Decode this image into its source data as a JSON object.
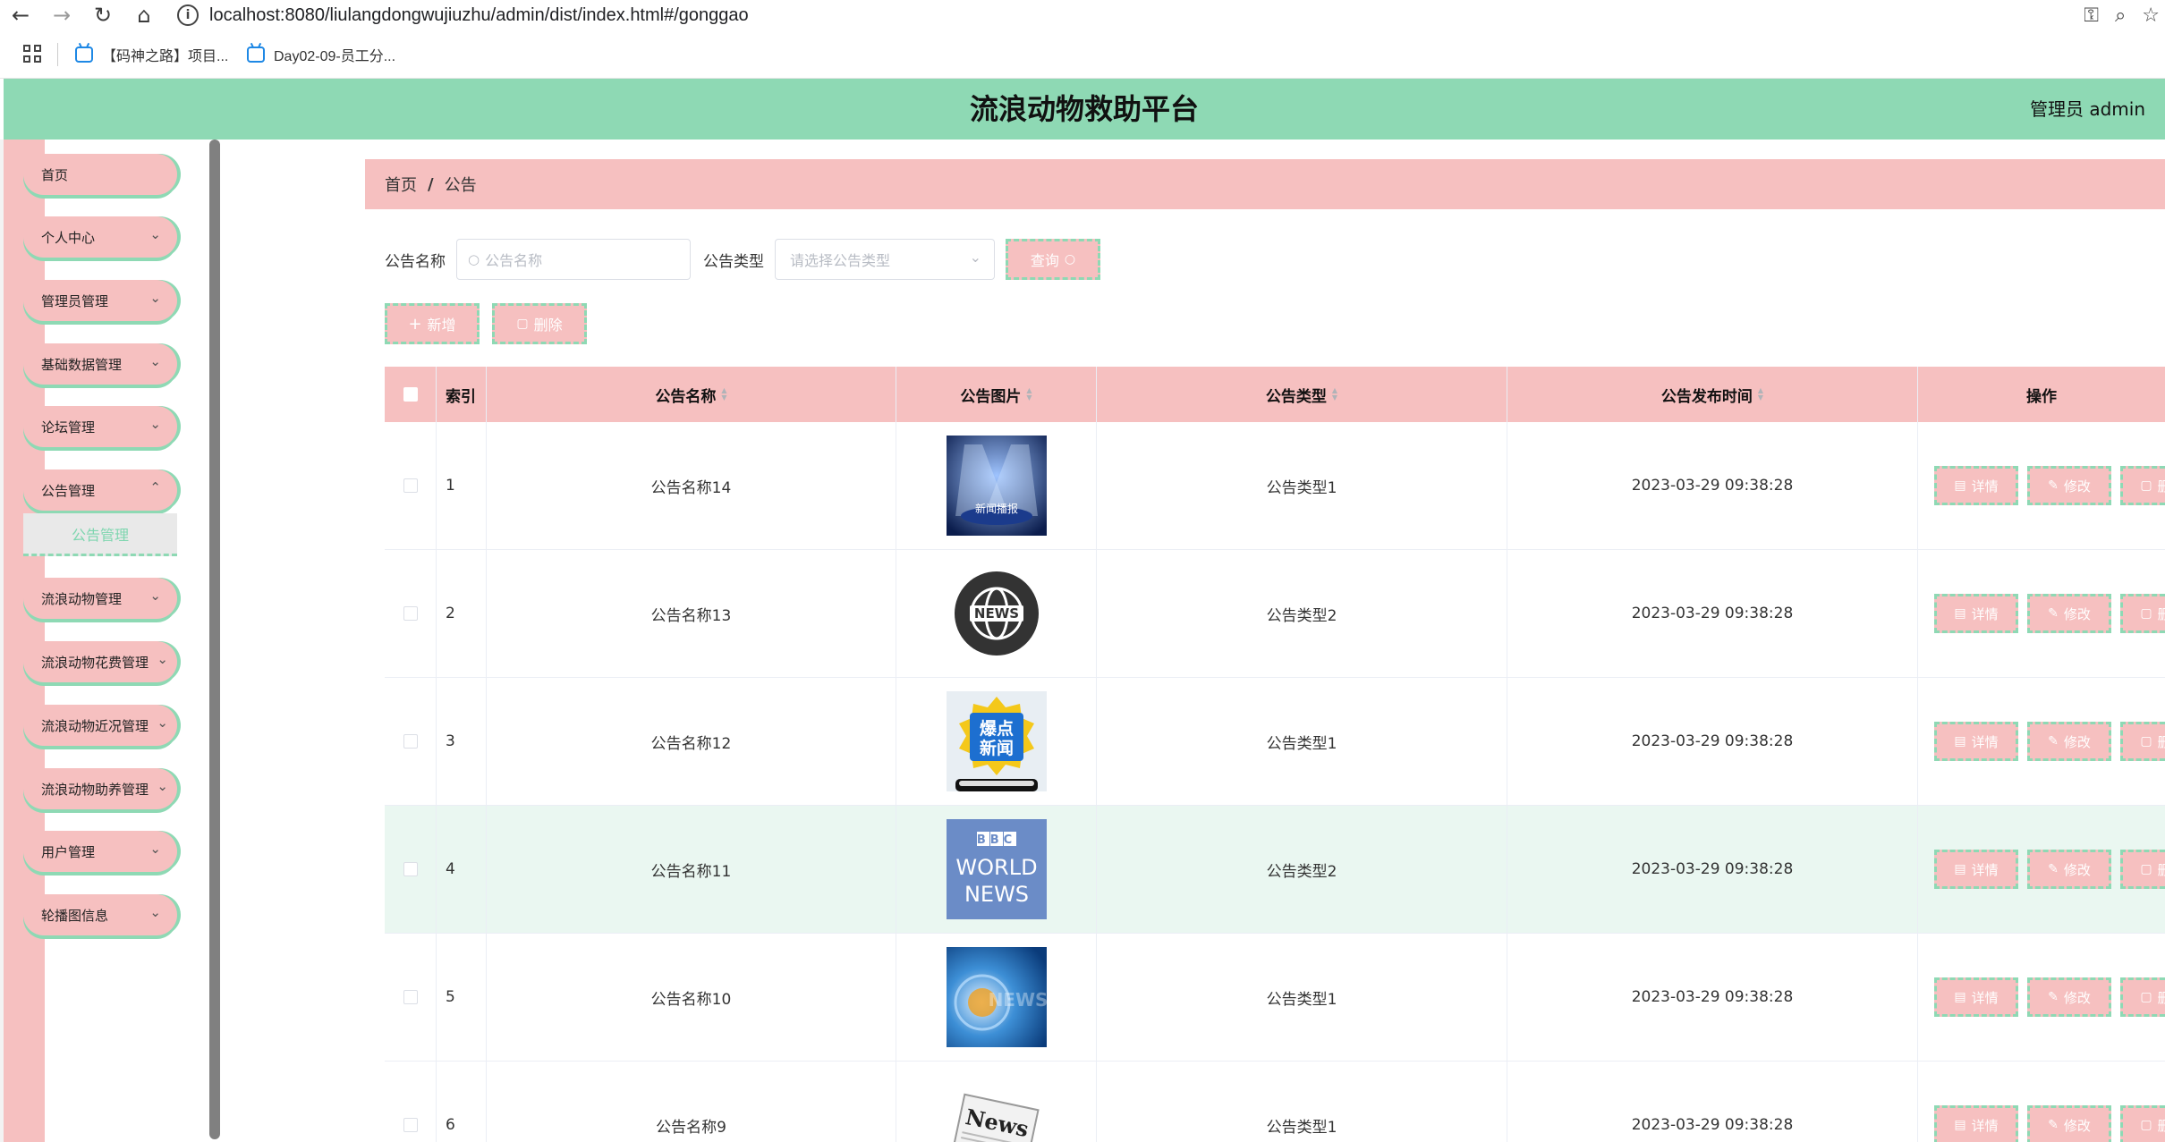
{
  "browser": {
    "url": "localhost:8080/liulangdongwujiuzhu/admin/dist/index.html#/gonggao",
    "bookmarks": [
      "【码神之路】项目...",
      "Day02-09-员工分..."
    ]
  },
  "header": {
    "title": "流浪动物救助平台",
    "user": "管理员 admin"
  },
  "sidebar": {
    "items": [
      {
        "label": "首页"
      },
      {
        "label": "个人中心"
      },
      {
        "label": "管理员管理"
      },
      {
        "label": "基础数据管理"
      },
      {
        "label": "论坛管理"
      },
      {
        "label": "公告管理"
      },
      {
        "label": "流浪动物管理"
      },
      {
        "label": "流浪动物花费管理"
      },
      {
        "label": "流浪动物近况管理"
      },
      {
        "label": "流浪动物助养管理"
      },
      {
        "label": "用户管理"
      },
      {
        "label": "轮播图信息"
      }
    ],
    "active_sub": "公告管理"
  },
  "breadcrumb": {
    "home": "首页",
    "current": "公告"
  },
  "search": {
    "name_label": "公告名称",
    "name_placeholder": "公告名称",
    "type_label": "公告类型",
    "type_placeholder": "请选择公告类型",
    "query_label": "查询"
  },
  "actions": {
    "add": "新增",
    "delete": "删除"
  },
  "table": {
    "columns": [
      "索引",
      "公告名称",
      "公告图片",
      "公告类型",
      "公告发布时间",
      "操作"
    ],
    "op_labels": {
      "detail": "详情",
      "edit": "修改",
      "delete": "删除"
    },
    "rows": [
      {
        "index": "1",
        "name": "公告名称14",
        "image": "stage-news-image",
        "type": "公告类型1",
        "time": "2023-03-29 09:38:28"
      },
      {
        "index": "2",
        "name": "公告名称13",
        "image": "globe-news-image",
        "type": "公告类型2",
        "time": "2023-03-29 09:38:28"
      },
      {
        "index": "3",
        "name": "公告名称12",
        "image": "breaking-news-image",
        "type": "公告类型1",
        "time": "2023-03-29 09:38:28"
      },
      {
        "index": "4",
        "name": "公告名称11",
        "image": "bbc-world-news-image",
        "type": "公告类型2",
        "time": "2023-03-29 09:38:28"
      },
      {
        "index": "5",
        "name": "公告名称10",
        "image": "blue-news-image",
        "type": "公告类型1",
        "time": "2023-03-29 09:38:28"
      },
      {
        "index": "6",
        "name": "公告名称9",
        "image": "newspaper-image",
        "type": "公告类型1",
        "time": "2023-03-29 09:38:28"
      }
    ],
    "image_text": {
      "stage": "新闻播报",
      "globe": "NEWS",
      "breaking_1": "爆点",
      "breaking_2": "新闻",
      "bbc": "BBC",
      "world": "WORLD",
      "news": "NEWS",
      "paper": "News"
    }
  },
  "colors": {
    "header": "#8ed9b4",
    "pink": "#f6c0c0",
    "dashed_border": "#8ed9b4",
    "row_highlight": "#eaf7f1"
  }
}
